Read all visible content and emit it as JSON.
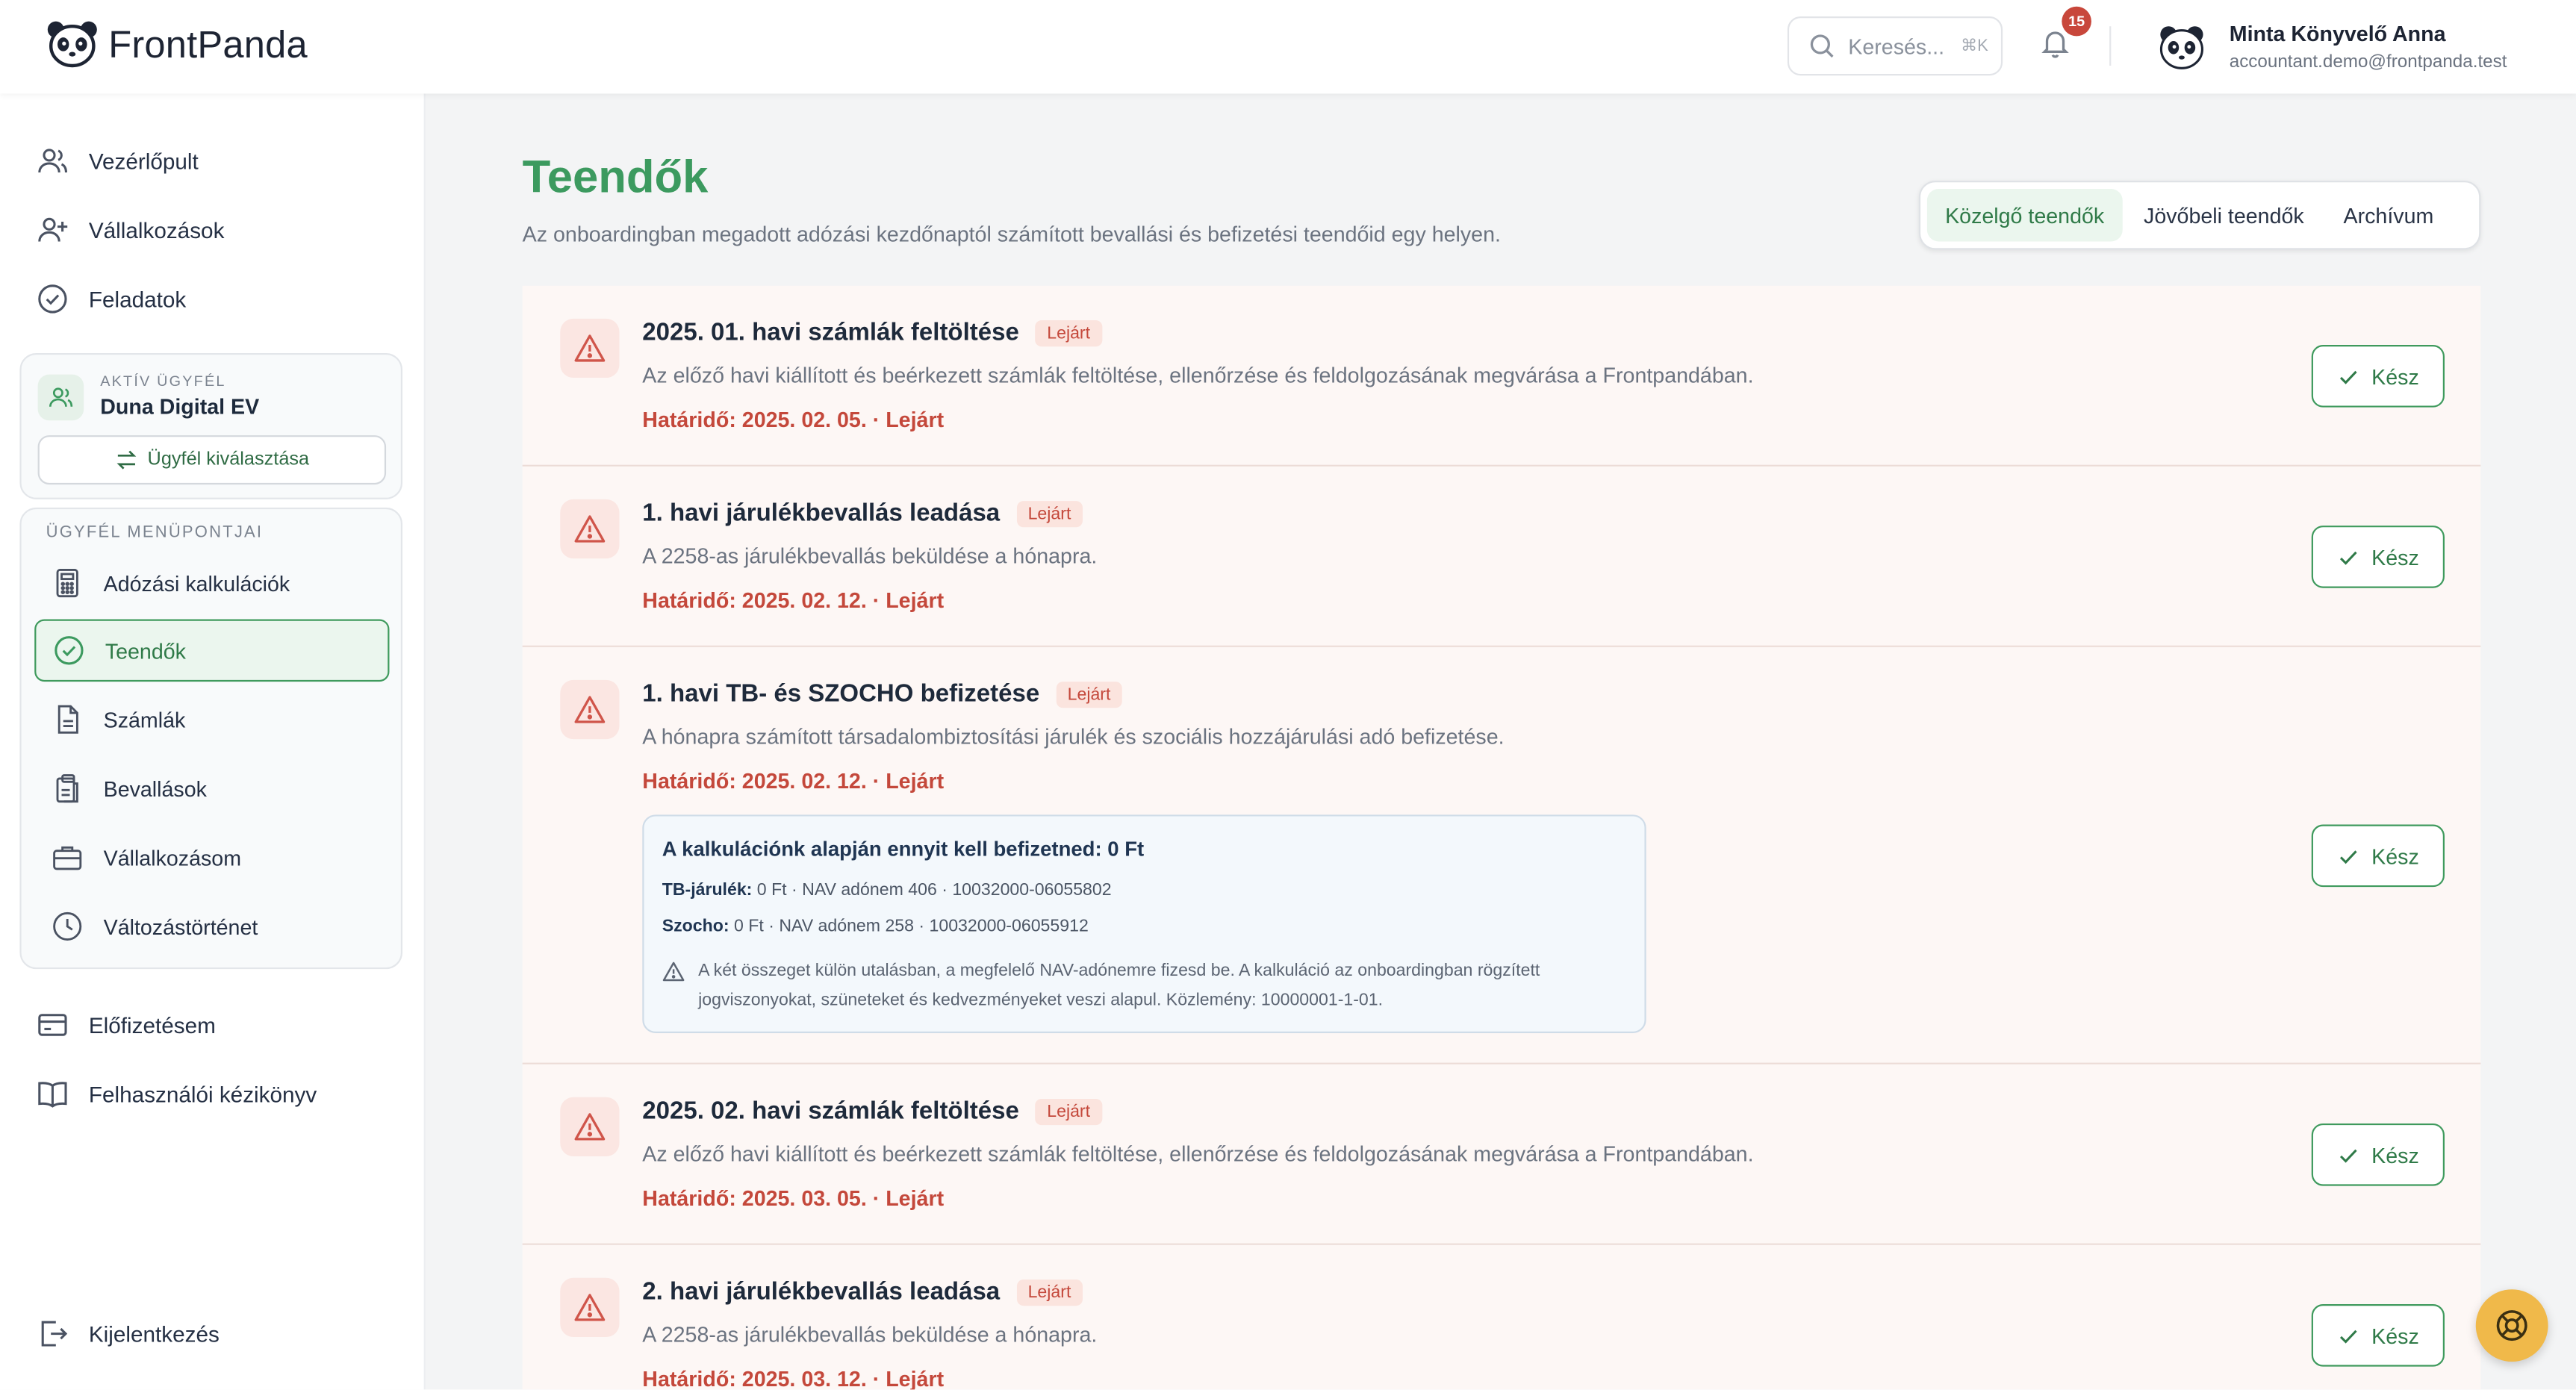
{
  "brand": {
    "name": "FrontPanda",
    "accent": "#3c9a5f",
    "danger": "#c4483b"
  },
  "header": {
    "search_placeholder": "Keresés...",
    "search_shortcut": "⌘K",
    "notifications_count": "15",
    "user_name": "Minta Könyvelő Anna",
    "user_email": "accountant.demo@frontpanda.test"
  },
  "sidebar": {
    "top_items": [
      {
        "label": "Vezérlőpult",
        "icon": "users-icon"
      },
      {
        "label": "Vállalkozások",
        "icon": "user-plus-icon"
      },
      {
        "label": "Feladatok",
        "icon": "check-circle-icon"
      }
    ],
    "client": {
      "label": "AKTÍV ÜGYFÉL",
      "name": "Duna Digital EV",
      "switch_label": "Ügyfél kiválasztása"
    },
    "client_menu": {
      "label": "ÜGYFÉL MENÜPONTJAI",
      "items": [
        {
          "label": "Adózási kalkulációk",
          "icon": "calculator-icon",
          "active": false
        },
        {
          "label": "Teendők",
          "icon": "check-circle-icon",
          "active": true
        },
        {
          "label": "Számlák",
          "icon": "document-icon",
          "active": false
        },
        {
          "label": "Bevallások",
          "icon": "clipboard-icon",
          "active": false
        },
        {
          "label": "Vállalkozásom",
          "icon": "briefcase-icon",
          "active": false
        },
        {
          "label": "Változástörténet",
          "icon": "clock-icon",
          "active": false
        }
      ]
    },
    "bottom_items": [
      {
        "label": "Előfizetésem",
        "icon": "credit-card-icon"
      },
      {
        "label": "Felhasználói kézikönyv",
        "icon": "book-icon"
      }
    ],
    "logout_label": "Kijelentkezés"
  },
  "main": {
    "title": "Teendők",
    "subtitle": "Az onboardingban megadott adózási kezdőnaptól számított bevallási és befizetési teendőid egy helyen.",
    "tabs": [
      {
        "label": "Közelgő teendők",
        "active": true
      },
      {
        "label": "Jövőbeli teendők",
        "active": false
      },
      {
        "label": "Archívum",
        "active": false
      }
    ],
    "done_label": "Kész",
    "tasks": [
      {
        "title": "2025. 01. havi számlák feltöltése",
        "status": "Lejárt",
        "description": "Az előző havi kiállított és beérkezett számlák feltöltése, ellenőrzése és feldolgozásának megvárása a Frontpandában.",
        "due": "Határidő: 2025. 02. 05. · Lejárt"
      },
      {
        "title": "1. havi járulékbevallás leadása",
        "status": "Lejárt",
        "description": "A 2258-as járulékbevallás beküldése a hónapra.",
        "due": "Határidő: 2025. 02. 12. · Lejárt"
      },
      {
        "title": "1. havi TB- és SZOCHO befizetése",
        "status": "Lejárt",
        "description": "A hónapra számított társadalombiztosítási járulék és szociális hozzájárulási adó befizetése.",
        "due": "Határidő: 2025. 02. 12. · Lejárt",
        "calculation": {
          "title": "A kalkulációnk alapján ennyit kell befizetned: 0 Ft",
          "tb_label": "TB-járulék:",
          "tb_value": "0 Ft · NAV adónem 406 · 10032000-06055802",
          "szocho_label": "Szocho:",
          "szocho_value": "0 Ft · NAV adónem 258 · 10032000-06055912",
          "note": "A két összeget külön utalásban, a megfelelő NAV-adónemre fizesd be. A kalkuláció az onboardingban rögzített jogviszonyokat, szüneteket és kedvezményeket veszi alapul. Közlemény: 10000001-1-01."
        }
      },
      {
        "title": "2025. 02. havi számlák feltöltése",
        "status": "Lejárt",
        "description": "Az előző havi kiállított és beérkezett számlák feltöltése, ellenőrzése és feldolgozásának megvárása a Frontpandában.",
        "due": "Határidő: 2025. 03. 05. · Lejárt"
      },
      {
        "title": "2. havi járulékbevallás leadása",
        "status": "Lejárt",
        "description": "A 2258-as járulékbevallás beküldése a hónapra.",
        "due": "Határidő: 2025. 03. 12. · Lejárt"
      }
    ]
  }
}
